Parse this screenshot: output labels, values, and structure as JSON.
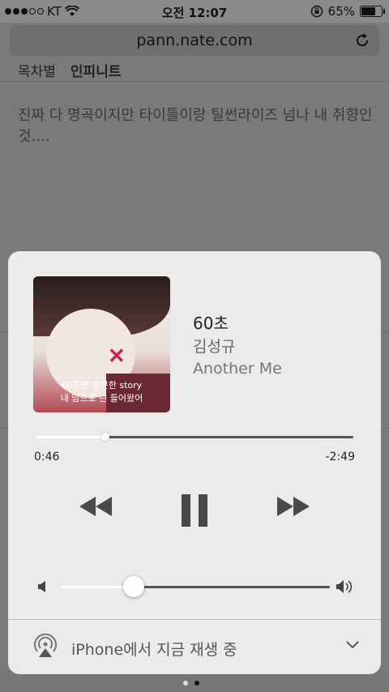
{
  "status_bar": {
    "carrier": "KT",
    "time": "오전 12:07",
    "battery": "65%",
    "battery_level": 0.65,
    "signal_bars": 3
  },
  "browser": {
    "url": "pann.nate.com"
  },
  "page": {
    "tabs": [
      "목차별",
      "인피니트"
    ],
    "comment": "진짜 다 명곡이지만 타이틀이랑 틸썬라이즈 넘나 내 취향인것...."
  },
  "now_playing": {
    "title": "60초",
    "artist": "김성규",
    "album": "Another Me",
    "album_art": {
      "line1": "60초면 충분한 story",
      "line2": "내 맘으로 넌 들어왔어"
    },
    "elapsed": "0:46",
    "remaining": "-2:49",
    "progress": 0.22,
    "volume": 0.27,
    "icons": {
      "rewind": "rewind-icon",
      "pause": "pause-icon",
      "fast_forward": "fast-forward-icon"
    }
  },
  "airplay": {
    "label": "iPhone에서 지금 재생 중"
  }
}
